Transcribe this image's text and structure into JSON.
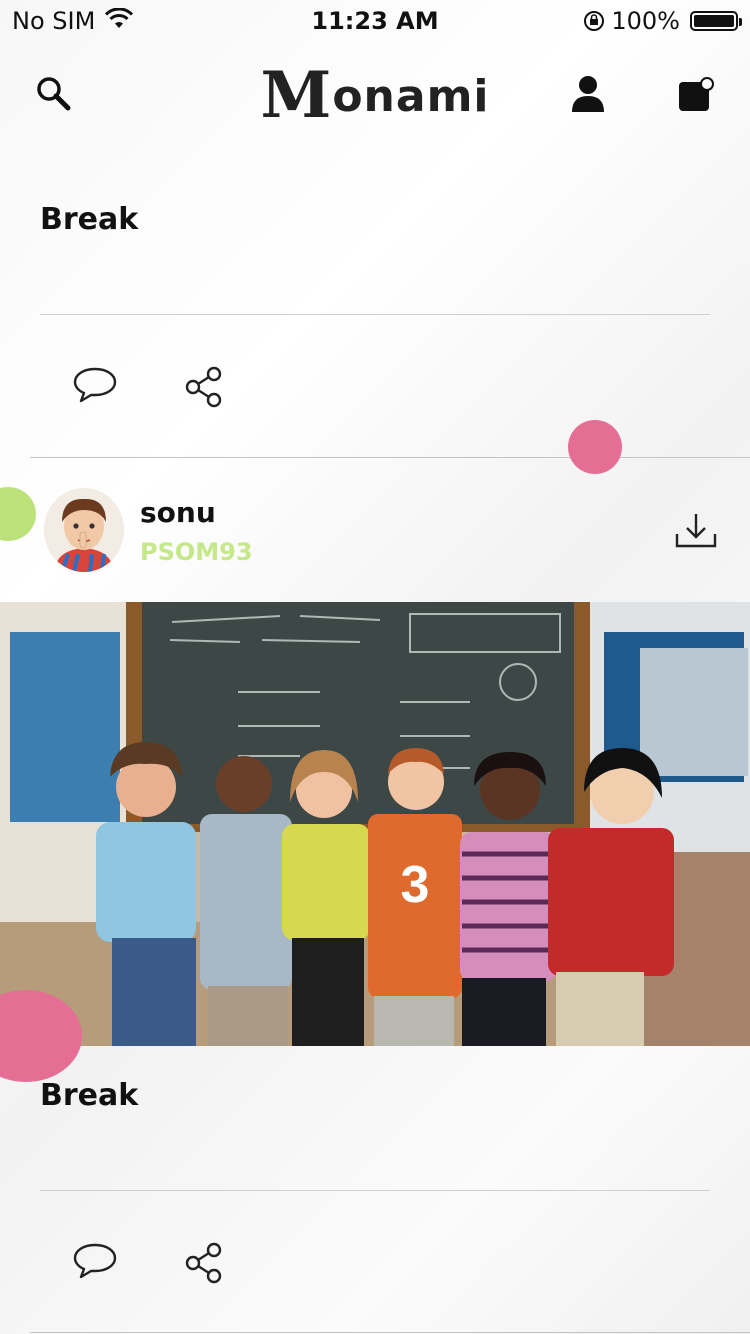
{
  "status_bar": {
    "carrier": "No SIM",
    "time": "11:23 AM",
    "battery_percent": "100%",
    "battery_level": 1.0
  },
  "header": {
    "logo_text": "onami",
    "logo_initial": "M"
  },
  "posts": [
    {
      "title": "Break"
    },
    {
      "user": {
        "name": "sonu",
        "code": "PSOM93"
      },
      "image_alt": "Children in classroom",
      "title": "Break"
    }
  ],
  "colors": {
    "accent_pink": "#e56e95",
    "accent_green": "#bde27a",
    "usercode_green": "#c5e88a"
  },
  "icons": [
    "search-icon",
    "profile-icon",
    "notification-icon",
    "comment-icon",
    "share-icon",
    "download-icon",
    "battery-icon",
    "wifi-icon",
    "lock-rotation-icon"
  ]
}
